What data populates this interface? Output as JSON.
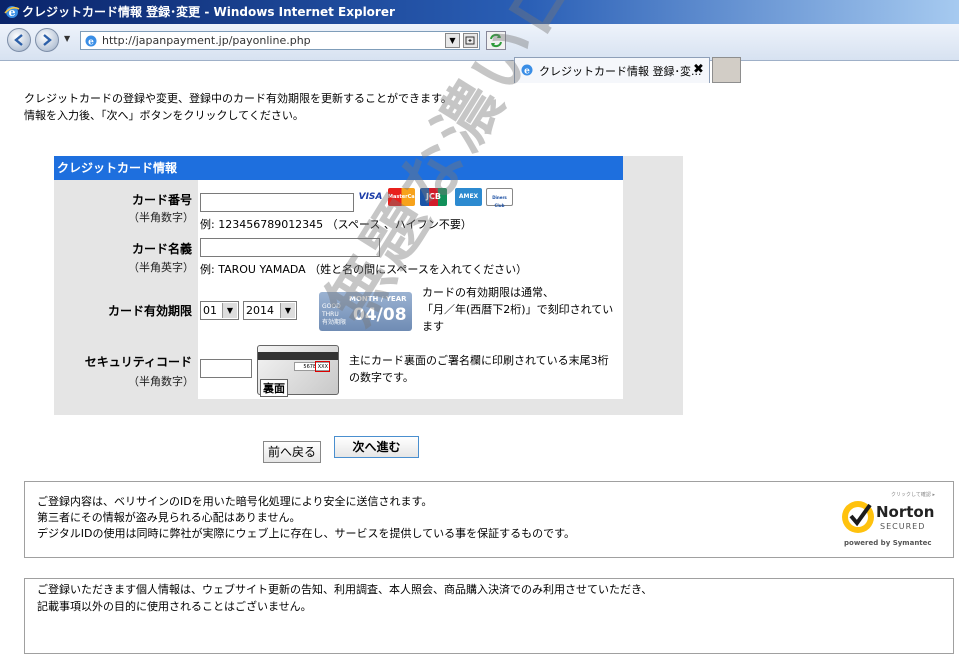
{
  "window": {
    "title": "クレジットカード情報 登録･変更 - Windows Internet Explorer"
  },
  "browser": {
    "url": "http://japanpayment.jp/payonline.php",
    "tab_label": "クレジットカード情報 登録･変...",
    "tab_close": "✖"
  },
  "intro": {
    "line1": "クレジットカードの登録や変更、登録中のカード有効期限を更新することができます。",
    "line2": "情報を入力後、「次へ」ボタンをクリックしてください。"
  },
  "form": {
    "header": "クレジットカード情報",
    "card_number": {
      "label": "カード番号",
      "sub": "（半角数字）",
      "value": "",
      "hint": "例: 123456789012345 （スペース 、ハイフン不要）"
    },
    "card_logos": [
      "VISA",
      "MasterCard",
      "JCB",
      "AMEX",
      "Diners Club"
    ],
    "card_name": {
      "label": "カード名義",
      "sub": "（半角英字）",
      "value": "",
      "hint": "例: TAROU YAMADA （姓と名の間にスペースを入れてください）"
    },
    "expiry": {
      "label": "カード有効期限",
      "month": "01",
      "year": "2014",
      "image_header": "MONTH / YEAR",
      "image_good": "GOOD",
      "image_thru": "THRU",
      "image_sub": "有効期限",
      "image_value": "04/08",
      "note_line1": "カードの有効期限は通常、",
      "note_line2": "「月／年(西暦下2桁)」で刻印されてい",
      "note_line3": "ます"
    },
    "security": {
      "label": "セキュリティコード",
      "sub": "（半角数字）",
      "value": "",
      "image_digits": "5678",
      "image_code": "XXX",
      "image_label": "裏面",
      "note_line1": "主にカード裏面のご署名欄に印刷されている末尾3桁",
      "note_line2": "の数字です。"
    }
  },
  "buttons": {
    "back": "前へ戻る",
    "next": "次へ進む"
  },
  "info_security": {
    "line1": "ご登録内容は、ベリサインのIDを用いた暗号化処理により安全に送信されます。",
    "line2": "第三者にその情報が盗み見られる心配はありません。",
    "line3": "デジタルIDの使用は同時に弊社が実際にウェブ上に存在し、サービスを提供している事を保証するものです。",
    "badge_top": "クリックして確認 ▸",
    "badge_norton": "Norton",
    "badge_secured": "SECURED",
    "badge_powered": "powered by Symantec"
  },
  "info_privacy": {
    "line1": "ご登録いただきます個人情報は、ウェブサイト更新の告知、利用調査、本人照会、商品購入決済でのみ利用させていただき、",
    "line2": "記載事項以外の目的に使用されることはございません。"
  },
  "watermark": "無題な濃いログ"
}
